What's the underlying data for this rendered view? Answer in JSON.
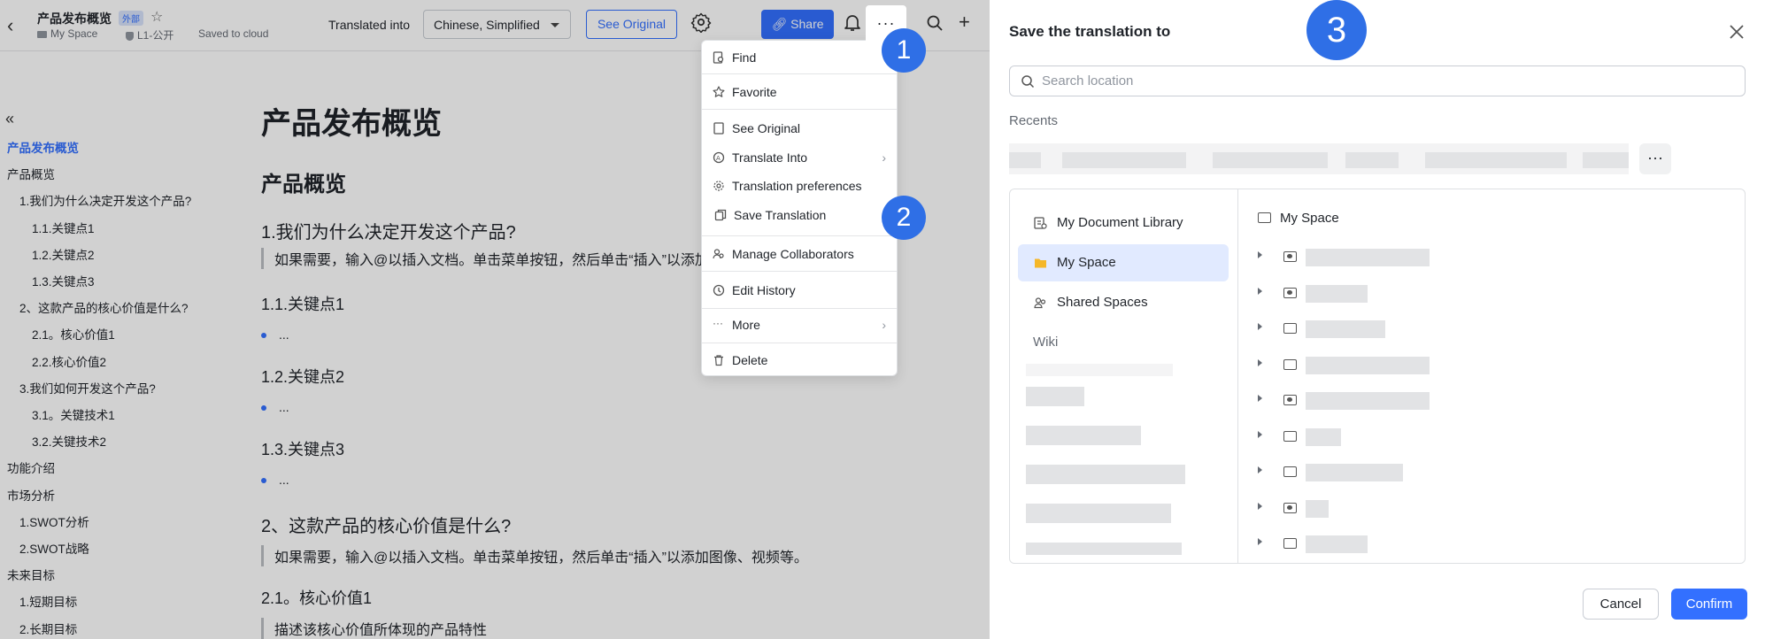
{
  "doc": {
    "title": "产品发布概览",
    "tag": "外部",
    "space": "My Space",
    "permission": "L1-公开",
    "save_status": "Saved to cloud",
    "translated_label": "Translated into",
    "language": "Chinese, Simplified",
    "see_original": "See Original",
    "share": "Share",
    "more": "···"
  },
  "toc": {
    "items": [
      {
        "label": "产品发布概览"
      },
      {
        "label": "产品概览"
      },
      {
        "label": "1.我们为什么决定开发这个产品?"
      },
      {
        "label": "1.1.关键点1"
      },
      {
        "label": "1.2.关键点2"
      },
      {
        "label": "1.3.关键点3"
      },
      {
        "label": "2、这款产品的核心价值是什么?"
      },
      {
        "label": "2.1。核心价值1"
      },
      {
        "label": "2.2.核心价值2"
      },
      {
        "label": "3.我们如何开发这个产品?"
      },
      {
        "label": "3.1。关键技术1"
      },
      {
        "label": "3.2.关键技术2"
      },
      {
        "label": "功能介绍"
      },
      {
        "label": "市场分析"
      },
      {
        "label": "1.SWOT分析"
      },
      {
        "label": "2.SWOT战略"
      },
      {
        "label": "未来目标"
      },
      {
        "label": "1.短期目标"
      },
      {
        "label": "2.长期目标"
      }
    ]
  },
  "content": {
    "title": "产品发布概览",
    "h_overview": "产品概览",
    "h_why": "1.我们为什么决定开发这个产品?",
    "quote1": "如果需要，输入@以插入文档。单击菜单按钮，然后单击“插入”以添加图像、视频等。",
    "h_k1": "1.1.关键点1",
    "bullet": "...",
    "h_k2": "1.2.关键点2",
    "h_k3": "1.3.关键点3",
    "h_core": "2、这款产品的核心价值是什么?",
    "quote2": "如果需要，输入@以插入文档。单击菜单按钮，然后单击“插入”以添加图像、视频等。",
    "h_cv1": "2.1。核心价值1",
    "quote3": "描述该核心价值所体现的产品特性"
  },
  "menu": {
    "find": "Find",
    "favorite": "Favorite",
    "see_original": "See Original",
    "translate_into": "Translate Into",
    "translation_prefs": "Translation preferences",
    "save_translation": "Save Translation",
    "manage_collaborators": "Manage Collaborators",
    "edit_history": "Edit History",
    "more": "More",
    "delete": "Delete"
  },
  "badges": {
    "one": "1",
    "two": "2",
    "three": "3"
  },
  "dialog": {
    "title": "Save the translation to",
    "search_placeholder": "Search location",
    "recents": "Recents",
    "nav": {
      "library": "My Document Library",
      "my_space": "My Space",
      "shared": "Shared Spaces",
      "wiki": "Wiki"
    },
    "tree_header": "My Space",
    "cancel": "Cancel",
    "confirm": "Confirm"
  },
  "colors": {
    "accent": "#3370ff",
    "badge": "#2f6fe6",
    "selected_bg": "#e1eaff"
  }
}
